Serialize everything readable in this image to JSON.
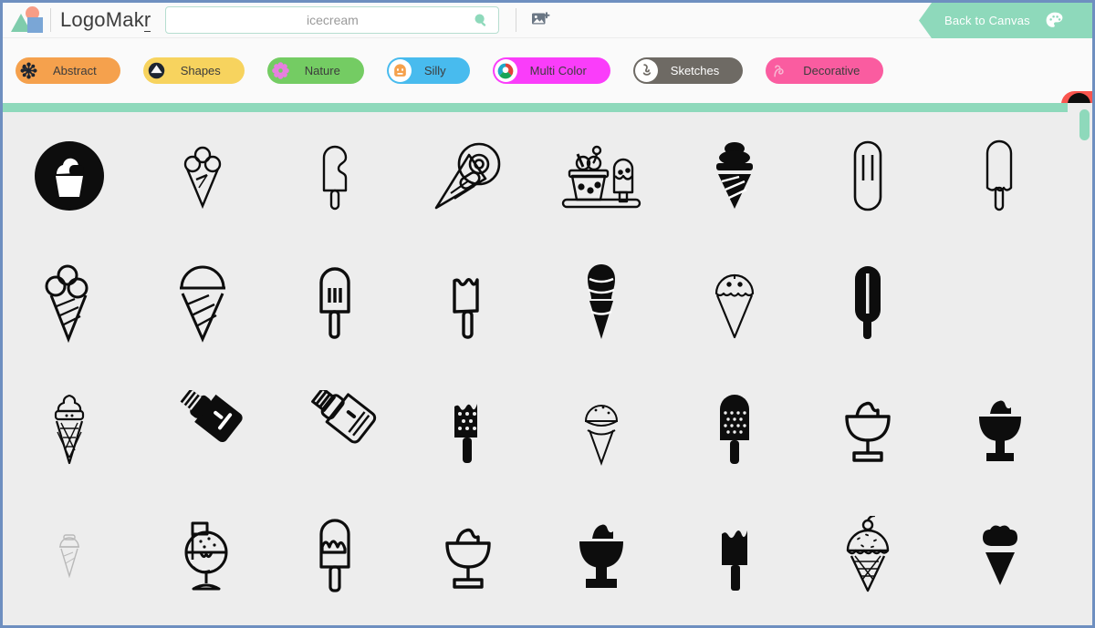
{
  "app": {
    "brand_name_main": "LogoMak",
    "brand_name_underlined": "r",
    "logo_icon": "logomakr-shapes-icon"
  },
  "search": {
    "value": "",
    "placeholder": "icecream",
    "icon": "search-icon"
  },
  "toolbar": {
    "add_image_icon": "add-image-icon",
    "back_to_canvas_label": "Back to Canvas",
    "palette_icon": "palette-icon"
  },
  "categories": [
    {
      "label": "Abstract",
      "pill_color": "#f5a14d",
      "badge_color": "#f5a14d",
      "text_color": "#3c3c3c",
      "icon": "asterisk-flower-icon",
      "icon_color": "#1c2430"
    },
    {
      "label": "Shapes",
      "pill_color": "#f7d35e",
      "badge_color": "#f7d35e",
      "text_color": "#3c3c3c",
      "icon": "circle-triangle-icon",
      "icon_color": "#1c2430"
    },
    {
      "label": "Nature",
      "pill_color": "#74cc63",
      "badge_color": "#74cc63",
      "text_color": "#3c3c3c",
      "icon": "flower-icon",
      "icon_color": "#e77fe0"
    },
    {
      "label": "Silly",
      "pill_color": "#48bbee",
      "badge_color": "#ffffff",
      "text_color": "#3c3c3c",
      "icon": "smiley-face-icon",
      "icon_color": "#f5a14d"
    },
    {
      "label": "Multi Color",
      "pill_color": "#fa3dfa",
      "badge_color": "#ffffff",
      "text_color": "#3c3c3c",
      "icon": "color-wheel-icon",
      "icon_color": "#e0413a"
    },
    {
      "label": "Sketches",
      "pill_color": "#6e6a64",
      "badge_color": "#ffffff",
      "text_color": "#ffffff",
      "icon": "sketch-hand-icon",
      "icon_color": "#6e6a64"
    },
    {
      "label": "Decorative",
      "pill_color": "#fa5ca0",
      "badge_color": "#fa5ca0",
      "text_color": "#3c3c3c",
      "icon": "swirl-icon",
      "icon_color": "#f0a8c8"
    }
  ],
  "edge_category": {
    "pill_color": "#f9554e",
    "badge_color": "#0d0d0d",
    "icon": "partial-category-icon"
  },
  "results": {
    "scroll_thumb_color": "#8ed9bb",
    "divider_color": "#8ed9bb",
    "background": "#ededed",
    "columns": 8,
    "icons": [
      {
        "name": "ice-cream-cup-badge-icon",
        "row": 1,
        "col": 1
      },
      {
        "name": "triple-scoop-cone-outline-icon",
        "row": 1,
        "col": 2
      },
      {
        "name": "bitten-popsicle-outline-icon",
        "row": 1,
        "col": 3
      },
      {
        "name": "cone-with-swirl-diagonal-icon",
        "row": 1,
        "col": 4
      },
      {
        "name": "sundae-and-popsicle-tray-icon",
        "row": 1,
        "col": 5
      },
      {
        "name": "soft-serve-cone-filled-icon",
        "row": 1,
        "col": 6
      },
      {
        "name": "twin-bar-popsicle-outline-icon",
        "row": 1,
        "col": 7
      },
      {
        "name": "melting-popsicle-outline-icon",
        "row": 1,
        "col": 8
      },
      {
        "name": "three-scoop-waffle-cone-icon",
        "row": 2,
        "col": 1
      },
      {
        "name": "waffle-cone-stripes-icon",
        "row": 2,
        "col": 2
      },
      {
        "name": "striped-popsicle-outline-icon",
        "row": 2,
        "col": 3
      },
      {
        "name": "bitten-square-popsicle-icon",
        "row": 2,
        "col": 4
      },
      {
        "name": "swirl-cone-filled-icon",
        "row": 2,
        "col": 5
      },
      {
        "name": "drip-cone-outline-icon",
        "row": 2,
        "col": 6
      },
      {
        "name": "double-bar-popsicle-filled-icon",
        "row": 2,
        "col": 7
      },
      {
        "name": "soft-serve-waffle-cone-icon",
        "row": 3,
        "col": 1
      },
      {
        "name": "piping-bag-filled-icon",
        "row": 3,
        "col": 2
      },
      {
        "name": "piping-bag-outline-icon",
        "row": 3,
        "col": 3
      },
      {
        "name": "dotted-popsicle-filled-icon",
        "row": 3,
        "col": 4
      },
      {
        "name": "dotted-scoop-cone-outline-icon",
        "row": 3,
        "col": 5
      },
      {
        "name": "halftone-popsicle-icon",
        "row": 3,
        "col": 6
      },
      {
        "name": "sundae-glass-outline-icon",
        "row": 3,
        "col": 7
      },
      {
        "name": "sundae-glass-filled-icon",
        "row": 3,
        "col": 8
      },
      {
        "name": "small-faded-cone-icon",
        "row": 4,
        "col": 1
      },
      {
        "name": "sundae-bowl-flag-icon",
        "row": 4,
        "col": 2
      },
      {
        "name": "drip-popsicle-outline-icon",
        "row": 4,
        "col": 3
      },
      {
        "name": "sundae-goblet-outline-icon",
        "row": 4,
        "col": 4
      },
      {
        "name": "sundae-goblet-filled-icon",
        "row": 4,
        "col": 5
      },
      {
        "name": "melting-popsicle-filled-icon",
        "row": 4,
        "col": 6
      },
      {
        "name": "cherry-sprinkle-cone-icon",
        "row": 4,
        "col": 7
      },
      {
        "name": "swirl-cone-solid-icon",
        "row": 4,
        "col": 8
      }
    ]
  }
}
